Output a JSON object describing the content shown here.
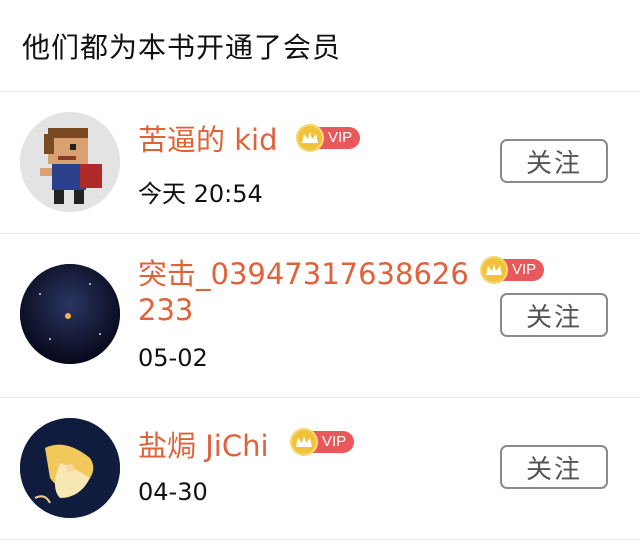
{
  "header": {
    "title": "他们都为本书开通了会员"
  },
  "members": [
    {
      "name": "苦逼的 kid",
      "time": "今天 20:54",
      "vip_label": "VIP",
      "follow_label": "关注"
    },
    {
      "name": "突击_03947317638626233",
      "time": "05-02",
      "vip_label": "VIP",
      "follow_label": "关注"
    },
    {
      "name": "盐焗 JiChi",
      "time": "04-30",
      "vip_label": "VIP",
      "follow_label": "关注"
    }
  ],
  "colors": {
    "name": "#e0623b",
    "vip_badge": "#e9585b",
    "crown": "#f3c23b"
  }
}
